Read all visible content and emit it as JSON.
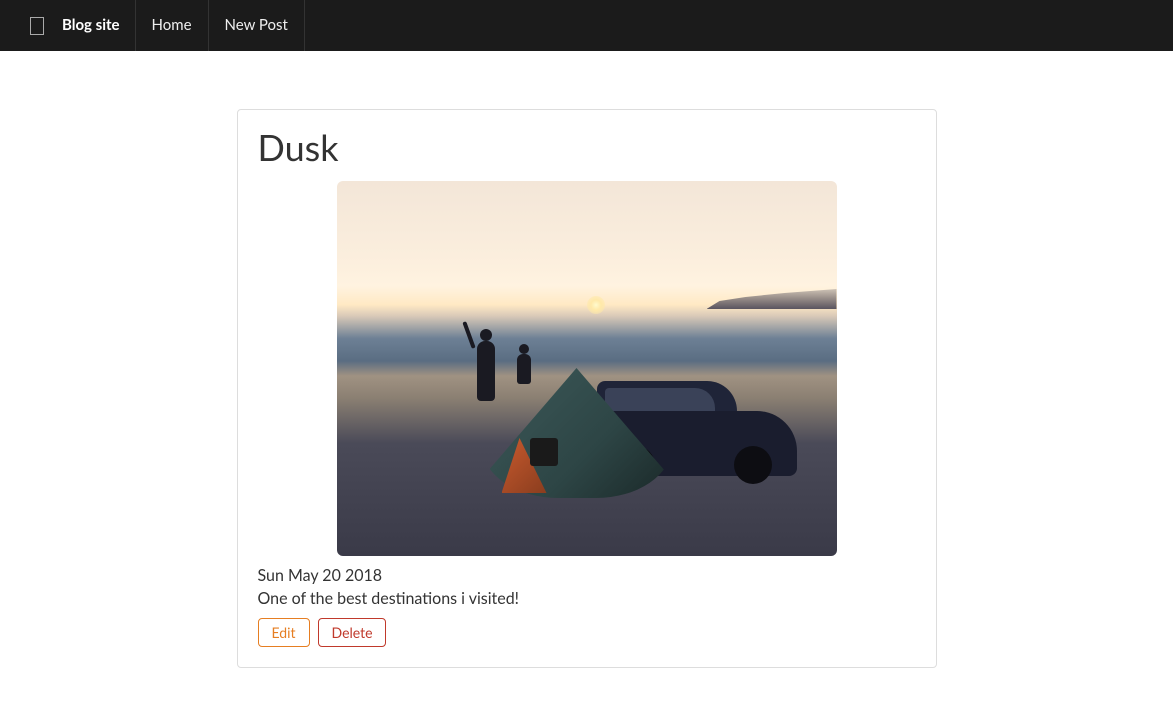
{
  "navbar": {
    "brand": "Blog site",
    "items": [
      {
        "label": "Home"
      },
      {
        "label": "New Post"
      }
    ]
  },
  "post": {
    "title": "Dusk",
    "date": "Sun May 20 2018",
    "description": "One of the best destinations i visited!",
    "actions": {
      "edit": "Edit",
      "delete": "Delete"
    }
  }
}
